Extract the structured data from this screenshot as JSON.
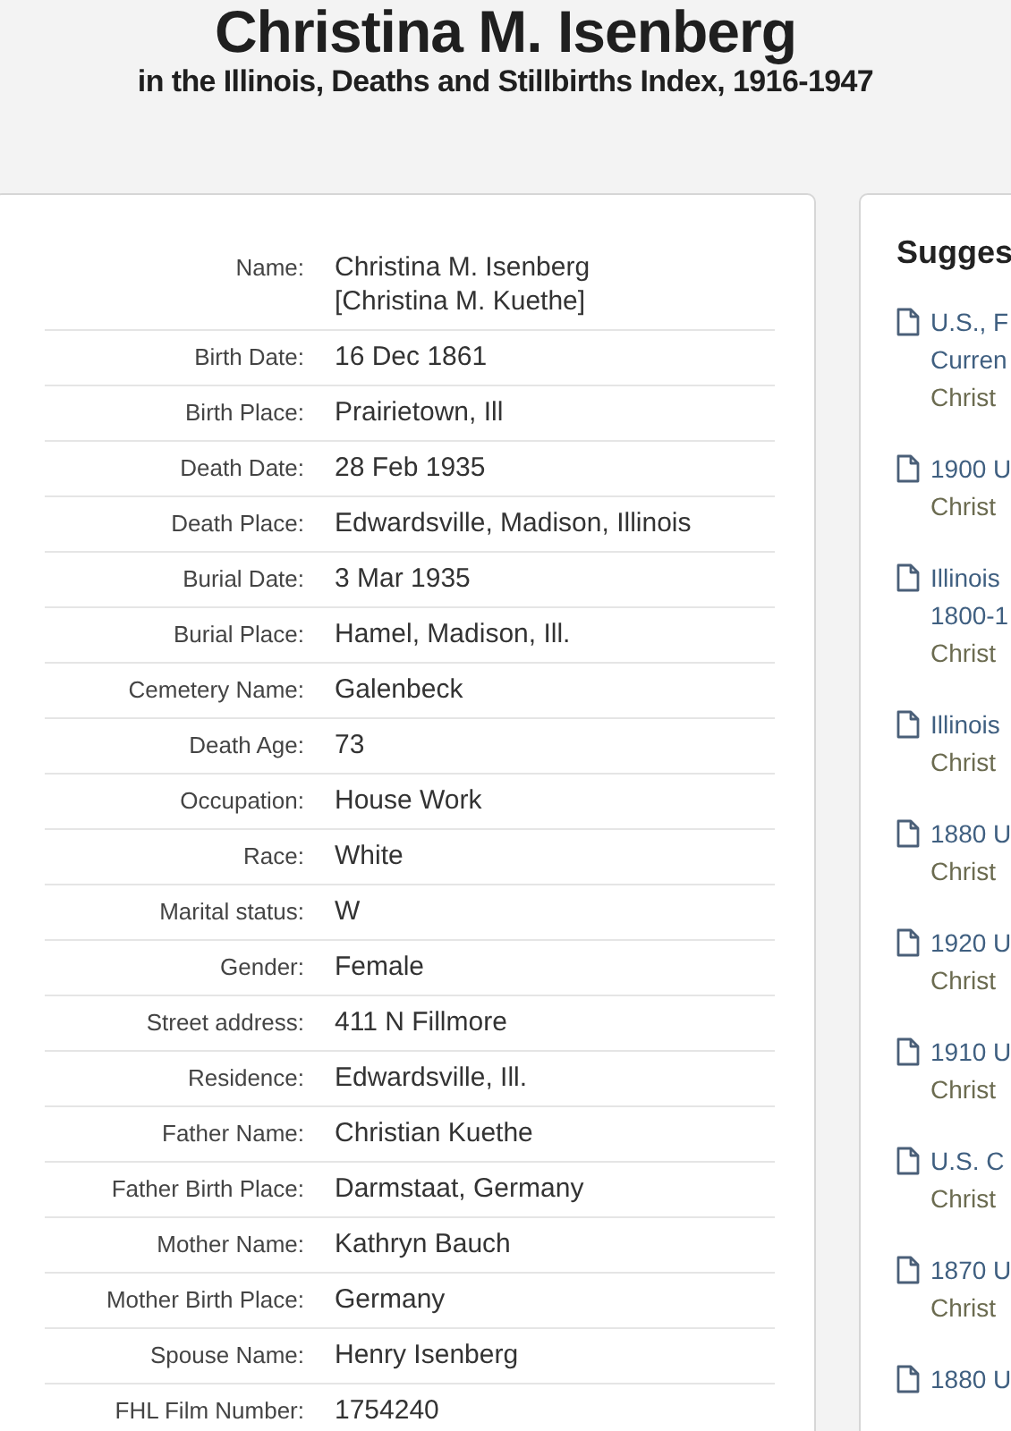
{
  "title": "Christina M. Isenberg",
  "subtitle": "in the Illinois, Deaths and Stillbirths Index, 1916-1947",
  "fields": [
    {
      "label": "Name:",
      "values": [
        "Christina M. Isenberg",
        "[Christina M. Kuethe]"
      ]
    },
    {
      "label": "Birth Date:",
      "values": [
        "16 Dec 1861"
      ]
    },
    {
      "label": "Birth Place:",
      "values": [
        "Prairietown, Ill"
      ]
    },
    {
      "label": "Death Date:",
      "values": [
        "28 Feb 1935"
      ]
    },
    {
      "label": "Death Place:",
      "values": [
        "Edwardsville, Madison, Illinois"
      ]
    },
    {
      "label": "Burial Date:",
      "values": [
        "3 Mar 1935"
      ]
    },
    {
      "label": "Burial Place:",
      "values": [
        "Hamel, Madison, Ill."
      ]
    },
    {
      "label": "Cemetery Name:",
      "values": [
        "Galenbeck"
      ]
    },
    {
      "label": "Death Age:",
      "values": [
        "73"
      ]
    },
    {
      "label": "Occupation:",
      "values": [
        "House Work"
      ]
    },
    {
      "label": "Race:",
      "values": [
        "White"
      ]
    },
    {
      "label": "Marital status:",
      "values": [
        "W"
      ]
    },
    {
      "label": "Gender:",
      "values": [
        "Female"
      ]
    },
    {
      "label": "Street address:",
      "values": [
        "411 N Fillmore"
      ]
    },
    {
      "label": "Residence:",
      "values": [
        "Edwardsville, Ill."
      ]
    },
    {
      "label": "Father Name:",
      "values": [
        "Christian Kuethe"
      ]
    },
    {
      "label": "Father Birth Place:",
      "values": [
        "Darmstaat, Germany"
      ]
    },
    {
      "label": "Mother Name:",
      "values": [
        "Kathryn Bauch"
      ]
    },
    {
      "label": "Mother Birth Place:",
      "values": [
        "Germany"
      ]
    },
    {
      "label": "Spouse Name:",
      "values": [
        "Henry Isenberg"
      ]
    },
    {
      "label": "FHL Film Number:",
      "values": [
        "1754240"
      ]
    }
  ],
  "suggested": {
    "heading": "Sugges",
    "items": [
      {
        "lines": [
          "U.S., F",
          "Curren"
        ],
        "person": "Christ"
      },
      {
        "lines": [
          "1900 U"
        ],
        "person": "Christ"
      },
      {
        "lines": [
          "Illinois",
          "1800-1"
        ],
        "person": "Christ"
      },
      {
        "lines": [
          "Illinois"
        ],
        "person": "Christ"
      },
      {
        "lines": [
          "1880 U"
        ],
        "person": "Christ"
      },
      {
        "lines": [
          "1920 U"
        ],
        "person": "Christ"
      },
      {
        "lines": [
          "1910 U"
        ],
        "person": "Christ"
      },
      {
        "lines": [
          "U.S. C"
        ],
        "person": "Christ"
      },
      {
        "lines": [
          "1870 U"
        ],
        "person": "Christ"
      },
      {
        "lines": [
          "1880 U"
        ]
      }
    ]
  }
}
